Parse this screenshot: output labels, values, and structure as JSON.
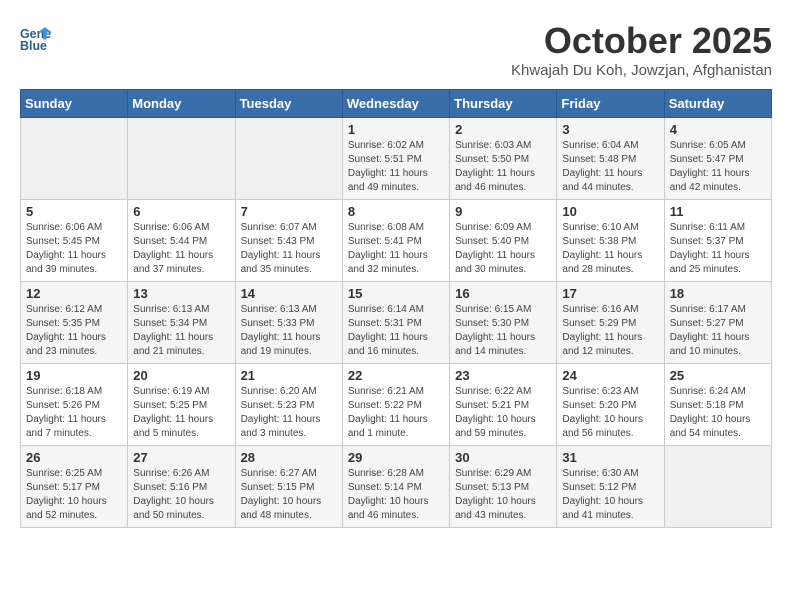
{
  "header": {
    "logo_line1": "General",
    "logo_line2": "Blue",
    "month": "October 2025",
    "location": "Khwajah Du Koh, Jowzjan, Afghanistan"
  },
  "weekdays": [
    "Sunday",
    "Monday",
    "Tuesday",
    "Wednesday",
    "Thursday",
    "Friday",
    "Saturday"
  ],
  "weeks": [
    [
      {
        "day": "",
        "sunrise": "",
        "sunset": "",
        "daylight": ""
      },
      {
        "day": "",
        "sunrise": "",
        "sunset": "",
        "daylight": ""
      },
      {
        "day": "",
        "sunrise": "",
        "sunset": "",
        "daylight": ""
      },
      {
        "day": "1",
        "sunrise": "Sunrise: 6:02 AM",
        "sunset": "Sunset: 5:51 PM",
        "daylight": "Daylight: 11 hours and 49 minutes."
      },
      {
        "day": "2",
        "sunrise": "Sunrise: 6:03 AM",
        "sunset": "Sunset: 5:50 PM",
        "daylight": "Daylight: 11 hours and 46 minutes."
      },
      {
        "day": "3",
        "sunrise": "Sunrise: 6:04 AM",
        "sunset": "Sunset: 5:48 PM",
        "daylight": "Daylight: 11 hours and 44 minutes."
      },
      {
        "day": "4",
        "sunrise": "Sunrise: 6:05 AM",
        "sunset": "Sunset: 5:47 PM",
        "daylight": "Daylight: 11 hours and 42 minutes."
      }
    ],
    [
      {
        "day": "5",
        "sunrise": "Sunrise: 6:06 AM",
        "sunset": "Sunset: 5:45 PM",
        "daylight": "Daylight: 11 hours and 39 minutes."
      },
      {
        "day": "6",
        "sunrise": "Sunrise: 6:06 AM",
        "sunset": "Sunset: 5:44 PM",
        "daylight": "Daylight: 11 hours and 37 minutes."
      },
      {
        "day": "7",
        "sunrise": "Sunrise: 6:07 AM",
        "sunset": "Sunset: 5:43 PM",
        "daylight": "Daylight: 11 hours and 35 minutes."
      },
      {
        "day": "8",
        "sunrise": "Sunrise: 6:08 AM",
        "sunset": "Sunset: 5:41 PM",
        "daylight": "Daylight: 11 hours and 32 minutes."
      },
      {
        "day": "9",
        "sunrise": "Sunrise: 6:09 AM",
        "sunset": "Sunset: 5:40 PM",
        "daylight": "Daylight: 11 hours and 30 minutes."
      },
      {
        "day": "10",
        "sunrise": "Sunrise: 6:10 AM",
        "sunset": "Sunset: 5:38 PM",
        "daylight": "Daylight: 11 hours and 28 minutes."
      },
      {
        "day": "11",
        "sunrise": "Sunrise: 6:11 AM",
        "sunset": "Sunset: 5:37 PM",
        "daylight": "Daylight: 11 hours and 25 minutes."
      }
    ],
    [
      {
        "day": "12",
        "sunrise": "Sunrise: 6:12 AM",
        "sunset": "Sunset: 5:35 PM",
        "daylight": "Daylight: 11 hours and 23 minutes."
      },
      {
        "day": "13",
        "sunrise": "Sunrise: 6:13 AM",
        "sunset": "Sunset: 5:34 PM",
        "daylight": "Daylight: 11 hours and 21 minutes."
      },
      {
        "day": "14",
        "sunrise": "Sunrise: 6:13 AM",
        "sunset": "Sunset: 5:33 PM",
        "daylight": "Daylight: 11 hours and 19 minutes."
      },
      {
        "day": "15",
        "sunrise": "Sunrise: 6:14 AM",
        "sunset": "Sunset: 5:31 PM",
        "daylight": "Daylight: 11 hours and 16 minutes."
      },
      {
        "day": "16",
        "sunrise": "Sunrise: 6:15 AM",
        "sunset": "Sunset: 5:30 PM",
        "daylight": "Daylight: 11 hours and 14 minutes."
      },
      {
        "day": "17",
        "sunrise": "Sunrise: 6:16 AM",
        "sunset": "Sunset: 5:29 PM",
        "daylight": "Daylight: 11 hours and 12 minutes."
      },
      {
        "day": "18",
        "sunrise": "Sunrise: 6:17 AM",
        "sunset": "Sunset: 5:27 PM",
        "daylight": "Daylight: 11 hours and 10 minutes."
      }
    ],
    [
      {
        "day": "19",
        "sunrise": "Sunrise: 6:18 AM",
        "sunset": "Sunset: 5:26 PM",
        "daylight": "Daylight: 11 hours and 7 minutes."
      },
      {
        "day": "20",
        "sunrise": "Sunrise: 6:19 AM",
        "sunset": "Sunset: 5:25 PM",
        "daylight": "Daylight: 11 hours and 5 minutes."
      },
      {
        "day": "21",
        "sunrise": "Sunrise: 6:20 AM",
        "sunset": "Sunset: 5:23 PM",
        "daylight": "Daylight: 11 hours and 3 minutes."
      },
      {
        "day": "22",
        "sunrise": "Sunrise: 6:21 AM",
        "sunset": "Sunset: 5:22 PM",
        "daylight": "Daylight: 11 hours and 1 minute."
      },
      {
        "day": "23",
        "sunrise": "Sunrise: 6:22 AM",
        "sunset": "Sunset: 5:21 PM",
        "daylight": "Daylight: 10 hours and 59 minutes."
      },
      {
        "day": "24",
        "sunrise": "Sunrise: 6:23 AM",
        "sunset": "Sunset: 5:20 PM",
        "daylight": "Daylight: 10 hours and 56 minutes."
      },
      {
        "day": "25",
        "sunrise": "Sunrise: 6:24 AM",
        "sunset": "Sunset: 5:18 PM",
        "daylight": "Daylight: 10 hours and 54 minutes."
      }
    ],
    [
      {
        "day": "26",
        "sunrise": "Sunrise: 6:25 AM",
        "sunset": "Sunset: 5:17 PM",
        "daylight": "Daylight: 10 hours and 52 minutes."
      },
      {
        "day": "27",
        "sunrise": "Sunrise: 6:26 AM",
        "sunset": "Sunset: 5:16 PM",
        "daylight": "Daylight: 10 hours and 50 minutes."
      },
      {
        "day": "28",
        "sunrise": "Sunrise: 6:27 AM",
        "sunset": "Sunset: 5:15 PM",
        "daylight": "Daylight: 10 hours and 48 minutes."
      },
      {
        "day": "29",
        "sunrise": "Sunrise: 6:28 AM",
        "sunset": "Sunset: 5:14 PM",
        "daylight": "Daylight: 10 hours and 46 minutes."
      },
      {
        "day": "30",
        "sunrise": "Sunrise: 6:29 AM",
        "sunset": "Sunset: 5:13 PM",
        "daylight": "Daylight: 10 hours and 43 minutes."
      },
      {
        "day": "31",
        "sunrise": "Sunrise: 6:30 AM",
        "sunset": "Sunset: 5:12 PM",
        "daylight": "Daylight: 10 hours and 41 minutes."
      },
      {
        "day": "",
        "sunrise": "",
        "sunset": "",
        "daylight": ""
      }
    ]
  ]
}
